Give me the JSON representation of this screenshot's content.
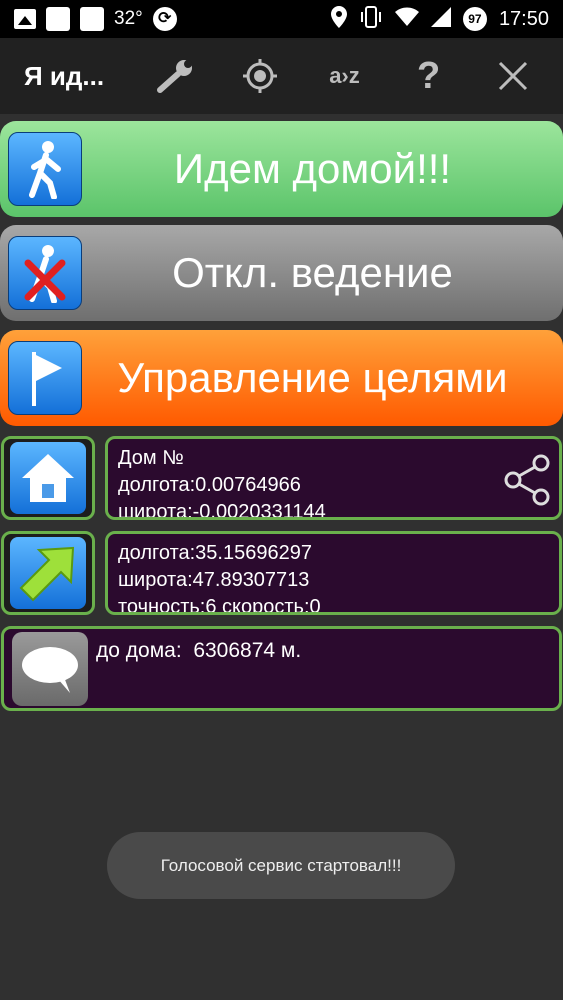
{
  "status_bar": {
    "temperature": "32°",
    "battery": "97",
    "time": "17:50"
  },
  "action_bar": {
    "title": "Я ид...",
    "icons": [
      "wrench-icon",
      "locate-icon",
      "sort-az-icon",
      "help-icon",
      "close-icon"
    ],
    "sort_label": "a›z",
    "help_label": "?"
  },
  "buttons": {
    "go_home": "Идем домой!!!",
    "disable_guidance": "Откл. ведение",
    "manage_targets": "Управление целями"
  },
  "home_info": {
    "line1": "Дом №",
    "line2": "долгота:0.00764966",
    "line3": "широта:-0.0020331144"
  },
  "position_info": {
    "line1": "долгота:35.15696297",
    "line2": "широта:47.89307713",
    "line3": "точность:6 скорость:0"
  },
  "distance_text": "до дома:  6306874 м.",
  "toast": "Голосовой сервис стартовал!!!",
  "colors": {
    "home_button": "#7dd68a",
    "off_button": "#8a8a8a",
    "target_button": "#ff7a1a",
    "border": "#6ab04c",
    "info_bg": "#2b0a2e"
  }
}
